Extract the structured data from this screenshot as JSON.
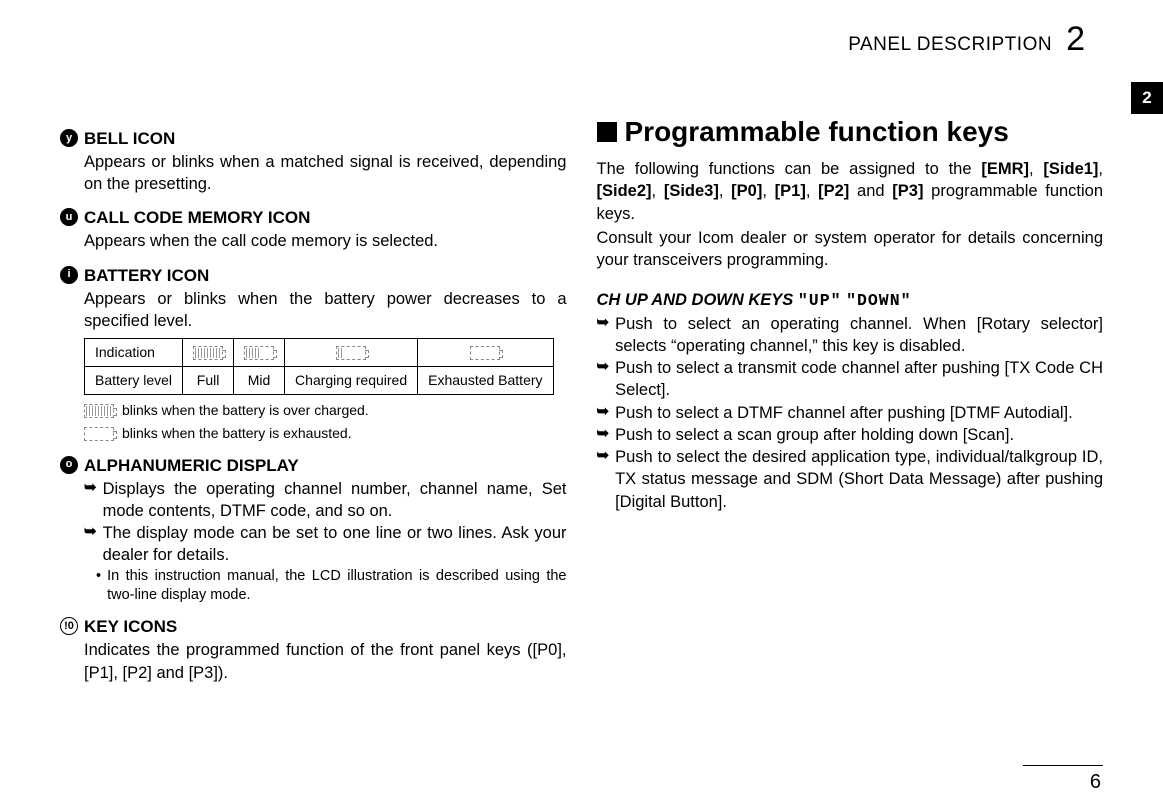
{
  "header": {
    "title": "PANEL DESCRIPTION",
    "chapter_number": "2",
    "tab_number": "2"
  },
  "left": {
    "items": [
      {
        "marker": "y",
        "title": "BELL ICON",
        "body": "Appears or blinks when a matched signal is received, depending on the presetting."
      },
      {
        "marker": "u",
        "title": "CALL CODE MEMORY ICON",
        "body": "Appears when the call code memory is selected."
      },
      {
        "marker": "i",
        "title": "BATTERY ICON",
        "body": "Appears or blinks when the battery power decreases to a specified level."
      }
    ],
    "battery_table": {
      "row1_label": "Indication",
      "row2_label": "Battery level",
      "levels": [
        "Full",
        "Mid",
        "Charging required",
        "Exhausted Battery"
      ]
    },
    "battery_legends": [
      "blinks when the battery is over charged.",
      "blinks when the battery is exhausted."
    ],
    "item_o": {
      "marker": "o",
      "title": "ALPHANUMERIC DISPLAY",
      "bullets": [
        "Displays the operating channel number, channel name, Set mode contents, DTMF code, and so on.",
        "The display mode can be set to one line or two lines. Ask your dealer for details."
      ],
      "note": "In this instruction manual, the LCD illustration is described using the two-line display mode."
    },
    "item_0": {
      "marker": "!0",
      "title": "KEY ICONS",
      "body": "Indicates the programmed function of the front panel keys ([P0], [P1], [P2] and [P3])."
    }
  },
  "right": {
    "heading": "Programmable function keys",
    "intro_prefix": "The following functions can be assigned to the ",
    "keys": [
      "[EMR]",
      "[Side1]",
      "[Side2]",
      "[Side3]",
      "[P0]",
      "[P1]",
      "[P2]",
      "[P3]"
    ],
    "intro_suffix": " programmable function keys.",
    "intro2": "Consult your Icom dealer or system operator for details concerning your transceivers programming.",
    "subsection_title": "CH UP AND DOWN KEYS",
    "lcd_labels": [
      "\"UP\"",
      "\"DOWN\""
    ],
    "bullets": [
      "Push to select an operating channel. When [Rotary selector] selects “operating channel,” this key is disabled.",
      "Push to select a transmit code channel after pushing [TX Code CH Select].",
      "Push to select a DTMF channel after pushing [DTMF Autodial].",
      "Push to select a scan group after holding down [Scan].",
      "Push to select the desired application type, individual/talkgroup ID, TX status message and SDM (Short Data Message) after pushing [Digital Button]."
    ]
  },
  "page_number": "6"
}
